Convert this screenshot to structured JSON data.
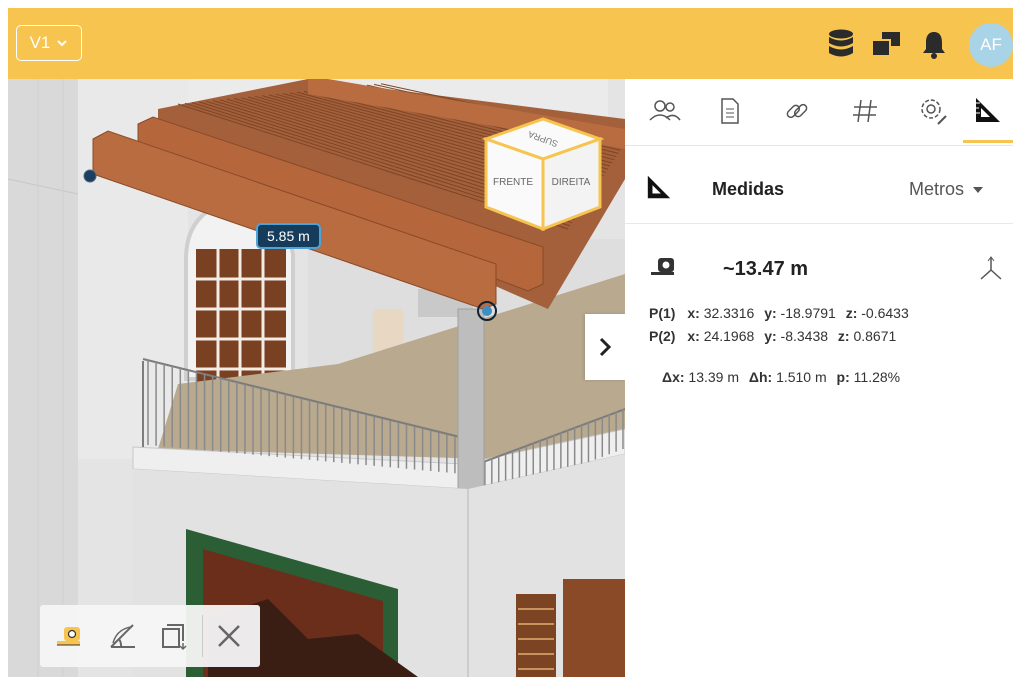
{
  "topbar": {
    "version_label": "V1",
    "icons": [
      "database-icon",
      "windows-icon",
      "bell-icon"
    ],
    "avatar_initials": "AF",
    "color": "#f6c44f"
  },
  "viewer": {
    "dimension_label": "5.85 m",
    "navcube": {
      "front": "FRENTE",
      "right": "DIREITA",
      "top": "SUPRA"
    },
    "toolbar_icons": [
      "tape-measure-icon",
      "angle-measure-icon",
      "area-measure-icon",
      "close-icon"
    ]
  },
  "panel": {
    "tabs": [
      "people-icon",
      "document-icon",
      "link-icon",
      "hash-icon",
      "settings-icon",
      "measure-icon"
    ],
    "active_tab": "measure-icon",
    "title": "Medidas",
    "units": "Metros",
    "distance": "~13.47 m",
    "p1": {
      "label": "P(1)",
      "x_label": "x:",
      "x": "32.3316",
      "y_label": "y:",
      "y": "-18.9791",
      "z_label": "z:",
      "z": "-0.6433"
    },
    "p2": {
      "label": "P(2)",
      "x_label": "x:",
      "x": "24.1968",
      "y_label": "y:",
      "y": "-8.3438",
      "z_label": "z:",
      "z": "0.8671"
    },
    "delta": {
      "dx_label": "Δx:",
      "dx": "13.39 m",
      "dh_label": "Δh:",
      "dh": "1.510 m",
      "p_label": "p:",
      "p": "11.28%"
    }
  }
}
